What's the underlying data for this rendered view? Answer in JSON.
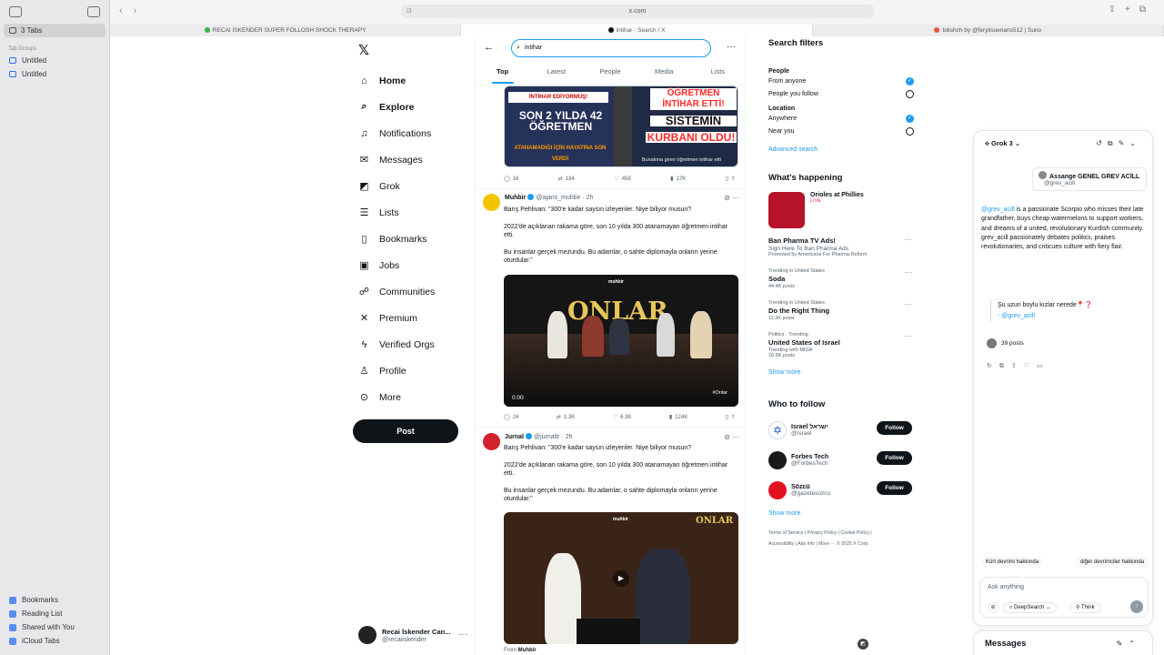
{
  "safari": {
    "tabs_label": "3 Tabs",
    "tab_groups_label": "Tab Groups",
    "groups": [
      "Untitled",
      "Untitled"
    ],
    "bottom": [
      "Bookmarks",
      "Reading List",
      "Shared with You",
      "iCloud Tabs"
    ],
    "url": "x.com",
    "tabs": [
      "RECAI İSKENDER SUPER FOLLOSH SHOCK THERAPY",
      "intihar - Search / X",
      "tolishch by @ferylisuenans512 | Suno"
    ]
  },
  "nav": {
    "items": [
      {
        "label": "Home",
        "icon": "home-icon"
      },
      {
        "label": "Explore",
        "icon": "search-icon"
      },
      {
        "label": "Notifications",
        "icon": "bell-icon"
      },
      {
        "label": "Messages",
        "icon": "mail-icon"
      },
      {
        "label": "Grok",
        "icon": "grok-icon"
      },
      {
        "label": "Lists",
        "icon": "list-icon"
      },
      {
        "label": "Bookmarks",
        "icon": "bookmark-icon"
      },
      {
        "label": "Jobs",
        "icon": "briefcase-icon"
      },
      {
        "label": "Communities",
        "icon": "people-icon"
      },
      {
        "label": "Premium",
        "icon": "x-icon"
      },
      {
        "label": "Verified Orgs",
        "icon": "lightning-icon"
      },
      {
        "label": "Profile",
        "icon": "person-icon"
      },
      {
        "label": "More",
        "icon": "more-circle-icon"
      }
    ],
    "post_label": "Post",
    "profile_name": "Recai İskender Can...",
    "profile_handle": "@recaiiskender"
  },
  "search": {
    "query": "intihar",
    "tabs": [
      "Top",
      "Latest",
      "People",
      "Media",
      "Lists"
    ]
  },
  "thumb1": {
    "left_top": "İNTİHAR EDİYORMUŞ!",
    "left_big": "SON 2 YILDA 42 ÖĞRETMEN",
    "left_small": "ATANAMADIĞI İÇİN HAYATINA SON VERDİ",
    "right_top": "ÖĞRETMEN İNTİHAR ETTİ!",
    "right_big1": "SİSTEMİN",
    "right_big2": "KURBANI OLDU!",
    "caption": "Bunalıma giren öğretmen intihar etti"
  },
  "tweet0_stats": {
    "replies": "16",
    "reposts": "184",
    "likes": "458",
    "views": "17K"
  },
  "tweet1": {
    "name": "Muhbir",
    "handle": "@ajans_muhbir · 2h",
    "line1": "Barış Pehlivan: \"300'e kadar saysın izleyenler. Niye biliyor musun?",
    "para2": "2022'de açıklanan rakama göre, son 10 yılda 300 atanamayan öğretmen intihar etti.",
    "para3": "Bu insanlar gerçek mezundu. Bu adamlar, o sahte diplomayla onların yerine oturdular.\"",
    "video_title": "ONLAR",
    "video_time": "0:00",
    "video_tag": "#Onlar",
    "stats": {
      "replies": "24",
      "reposts": "1.3K",
      "likes": "6.3K",
      "views": "124K"
    }
  },
  "tweet2": {
    "name": "Jurnal",
    "handle": "@jurnaltr · 2h",
    "line1": "Barış Pehlivan: \"300'e kadar saysın izleyenler. Niye biliyor musun?",
    "para2": "2022'de açıklanan rakama göre, son 10 yılda 300 atanamayan öğretmen intihar etti.",
    "para3": "Bu insanlar gerçek mezundu. Bu adamlar, o sahte diplomayla onların yerine oturdular.\"",
    "video_title": "ONLAR",
    "from": "From",
    "from_name": "Muhbir"
  },
  "filters": {
    "title": "Search filters",
    "people": "People",
    "from_anyone": "From anyone",
    "people_you_follow": "People you follow",
    "location": "Location",
    "anywhere": "Anywhere",
    "near_you": "Near you",
    "advanced": "Advanced search"
  },
  "happening": {
    "title": "What's happening",
    "event_name": "Orioles at Phillies",
    "event_status": "LIVE",
    "ad_name": "Ban Pharma TV Ads!",
    "ad_sub": "Sign Here To Ban Pharma Ads",
    "ad_promo": "Promoted by Americans For Pharma Reform",
    "trends": [
      {
        "cat": "Trending in United States",
        "name": "Soda",
        "count": "44.4K posts"
      },
      {
        "cat": "Trending in United States",
        "name": "Do the Right Thing",
        "count": "11.3K posts"
      },
      {
        "cat": "Politics · Trending",
        "name": "United States of Israel",
        "count": "Trending with MIGA",
        "count2": "16.6K posts"
      }
    ],
    "show_more": "Show more"
  },
  "who": {
    "title": "Who to follow",
    "accounts": [
      {
        "name": "Israel ישראל",
        "handle": "@Israel"
      },
      {
        "name": "Forbes Tech",
        "handle": "@ForbesTech"
      },
      {
        "name": "Sözcü",
        "handle": "@gazetesozcu"
      }
    ],
    "follow": "Follow",
    "show_more": "Show more"
  },
  "footer": {
    "line1": "Terms of Service  |  Privacy Policy  |  Cookie Policy  |",
    "line2": "Accessibility  |  Ads info  |  More ···  © 2025 X Corp."
  },
  "grok": {
    "model": "Grok 3",
    "user_name": "Assange GENEL GREV ACİLL",
    "user_handle": "@grev_acill",
    "mention": "@grev_acill",
    "body": " is a passionate Scorpio who misses their late grandfather, buys cheap watermelons to support workers, and dreams of a united, revolutionary Kurdish community. grev_acill passionately debates politics, praises revolutionaries, and criticues culture with fiery flair.",
    "quote": "Şu uzun boylu kızlar nerede📍❓",
    "quote_handle": "- @grev_acill",
    "posts": "39 posts",
    "chips": [
      "Kürt devrimi hakkında",
      "diğer devrimciler hakkında"
    ],
    "ask_placeholder": "Ask anything",
    "deepsearch": "DeepSearch",
    "think": "Think"
  },
  "messages": {
    "title": "Messages"
  },
  "colors": {
    "accent": "#1d9bf0",
    "text": "#0f1419",
    "muted": "#536471"
  }
}
